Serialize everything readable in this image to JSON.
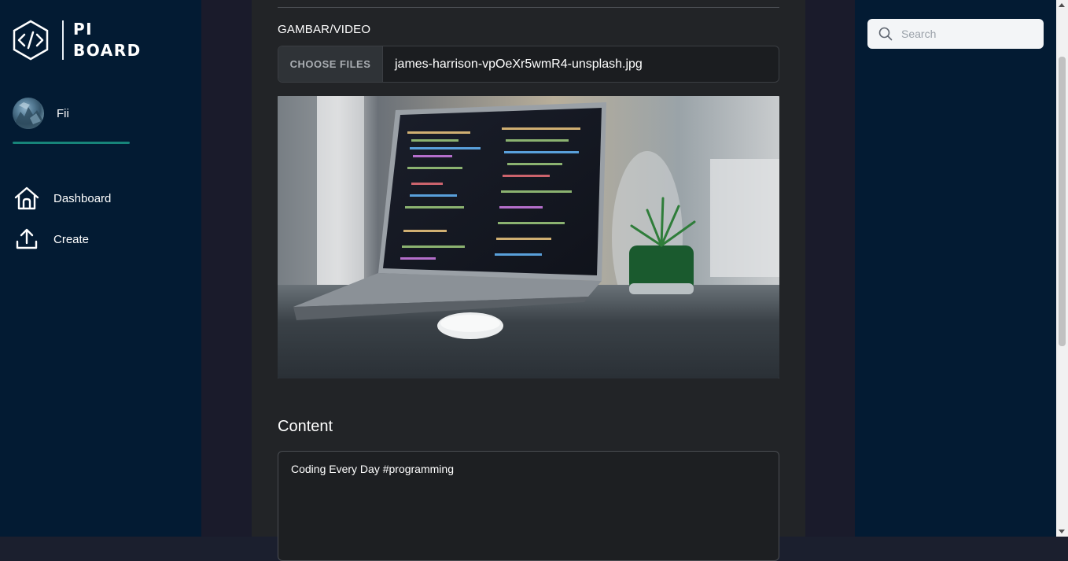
{
  "app": {
    "logo_line1": "PI",
    "logo_line2": "BOARD"
  },
  "user": {
    "name": "Fii"
  },
  "nav": {
    "items": [
      {
        "label": "Dashboard",
        "icon": "home-icon"
      },
      {
        "label": "Create",
        "icon": "upload-icon"
      }
    ]
  },
  "form": {
    "media_label": "GAMBAR/VIDEO",
    "choose_files_label": "CHOOSE FILES",
    "file_name": "james-harrison-vpOeXr5wmR4-unsplash.jpg",
    "content_label": "Content",
    "content_value": "Coding Every Day #programming"
  },
  "search": {
    "placeholder": "Search"
  },
  "colors": {
    "sidebar_bg": "#031b33",
    "main_bg": "#222427",
    "accent": "#17857a"
  }
}
